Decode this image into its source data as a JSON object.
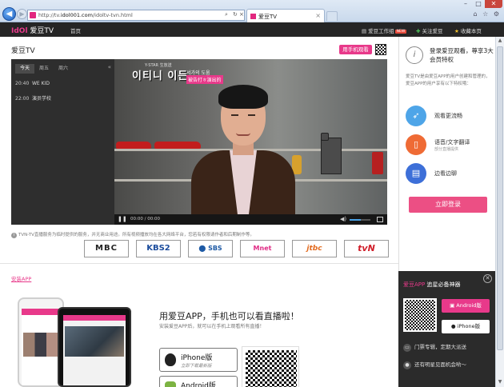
{
  "browser": {
    "url_prefix": "http://tv.",
    "url_domain": "idol001.com",
    "url_path": "/idoltv-tvn.html",
    "tab_title": "爱豆TV",
    "tab_close": "×",
    "window_min": "–",
    "window_max": "□",
    "window_close": "✕",
    "tools": "⌂ ☆ ⚙"
  },
  "topbar": {
    "logo_mark": "IdOl",
    "logo_text": "爱豆TV",
    "home": "首页",
    "studio": "爱豆工作组",
    "studio_badge": "NEW",
    "follow": "关注爱豆",
    "favorite": "收藏本页"
  },
  "main": {
    "page_title": "爱豆TV",
    "mobile_button": "用手机观看"
  },
  "schedule": {
    "tabs": [
      "今天",
      "周五",
      "周六"
    ],
    "arrow": "«",
    "rows": [
      {
        "time": "20:40",
        "show": "WE KID"
      },
      {
        "time": "22:00",
        "show": "演员学校"
      }
    ]
  },
  "player": {
    "overlay_top": "Y-STAR 生放送",
    "overlay_title": "이티니 이든",
    "caption_line1": "서가의 도움",
    "caption_line2": "被告打ㅎ演出的",
    "time": "00:00 / 00:00",
    "volume_level": 0.55
  },
  "notice": "TVN-TV直播服务为临时提供的服务，并无商业用途。所有视频播放均在各大网络平台，您若有权限请作者和后期制作等。",
  "channels": [
    "MBC",
    "KBS2",
    "SBS",
    "Mnet",
    "jtbc",
    "tvN"
  ],
  "app": {
    "install_link": "安装APP",
    "title": "用爱豆APP，手机也可以看直播啦！",
    "subtitle": "安装爱豆APP后，就可以在手机上观看所有直播！",
    "ios_name": "iPhone版",
    "ios_sub": "立即下载最新版",
    "android_name": "Android版"
  },
  "sidebar": {
    "title": "登录爱豆观看，尊享3大会员特权",
    "desc": "爱豆TV是由爱豆APP的用户创建和管理的，爱豆APP的用户享有以下特权哦：",
    "features": [
      {
        "label": "观看更流畅",
        "sub": ""
      },
      {
        "label": "语音/文字翻译",
        "sub": "部分直播提供"
      },
      {
        "label": "边看边聊",
        "sub": ""
      }
    ],
    "login": "立即登录"
  },
  "popup": {
    "title_brand": "爱豆APP",
    "title_rest": " 追星必备神器",
    "android": "Android版",
    "iphone": "iPhone版",
    "line1": "门票专辑，定期大派送",
    "line2": "还有明星见面机会哟～"
  },
  "colors": {
    "accent": "#e8398a",
    "topbar_bg": "#252525",
    "login_button": "#ec4f84"
  }
}
